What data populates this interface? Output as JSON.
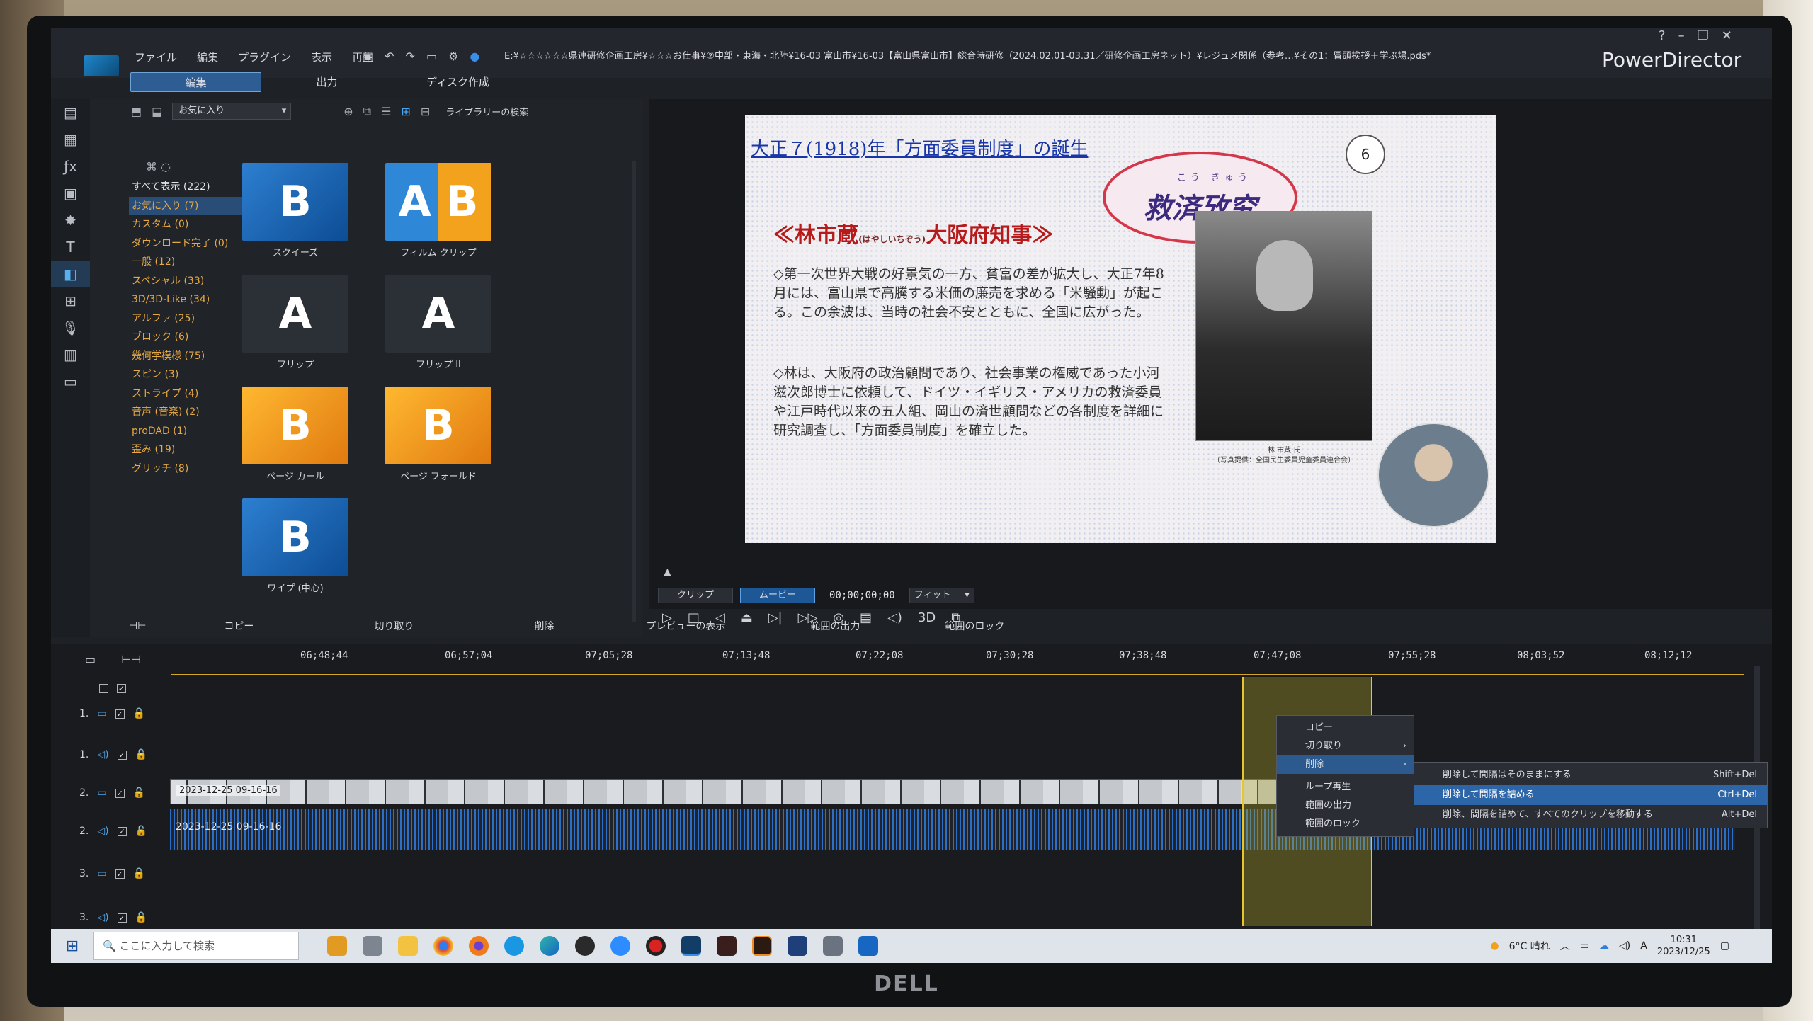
{
  "monitor_brand": "DELL",
  "menu": [
    "ファイル",
    "編集",
    "プラグイン",
    "表示",
    "再生"
  ],
  "project_path": "E:¥☆☆☆☆☆☆県連研修企画工房¥☆☆☆お仕事¥②中部・東海・北陸¥16-03 富山市¥16-03【富山県富山市】総合時研修（2024.02.01-03.31／研修企画工房ネット）¥レジュメ関係（参考…¥その1：冒頭挨拶＋学ぶ場.pds*",
  "app_name": "PowerDirector",
  "win_controls": [
    "?",
    "–",
    "❐",
    "✕"
  ],
  "modes": [
    "編集",
    "出力",
    "ディスク作成"
  ],
  "library": {
    "dropdown": "お気に入り",
    "link": "ライブラリーの検索",
    "categories": [
      "すべて表示 (222)",
      "お気に入り (7)",
      "カスタム (0)",
      "ダウンロード完了 (0)",
      "一般 (12)",
      "スペシャル (33)",
      "3D/3D-Like (34)",
      "アルファ (25)",
      "ブロック (6)",
      "幾何学模様 (75)",
      "スピン (3)",
      "ストライプ (4)",
      "音声 (音楽) (2)",
      "proDAD (1)",
      "歪み (19)",
      "グリッチ (8)"
    ],
    "thumbnails": [
      {
        "label": "スクイーズ",
        "glyph": "B"
      },
      {
        "label": "フィルム クリップ",
        "glyph": "A B"
      },
      {
        "label": "フリップ",
        "glyph": "A"
      },
      {
        "label": "フリップ II",
        "glyph": "A"
      },
      {
        "label": "ページ カール",
        "glyph": "B"
      },
      {
        "label": "ページ フォールド",
        "glyph": "B"
      },
      {
        "label": "ワイプ (中心)",
        "glyph": "B"
      }
    ]
  },
  "slide": {
    "title": "大正７(1918)年「方面委員制度」の誕生",
    "number": "6",
    "stamp_ruby": "こう きゅう",
    "stamp": "救済攷究",
    "heading_left": "≪林市蔵",
    "heading_ruby": "(はやしいちぞう)",
    "heading_right": "大阪府知事≫",
    "bullet1": "◇第一次世界大戦の好景気の一方、貧富の差が拡大し、大正7年8月には、富山県で高騰する米価の廉売を求める「米騒動」が起こる。この余波は、当時の社会不安とともに、全国に広がった。",
    "bullet2": "◇林は、大阪府の政治顧問であり、社会事業の権威であった小河滋次郎博士に依頼して、ドイツ・イギリス・アメリカの救済委員や江戸時代以来の五人組、岡山の済世顧問などの各制度を詳細に研究調査し、「方面委員制度」を確立した。",
    "photo_caption": "林 市蔵 氏\n（写真提供：全国民生委員児童委員連合会）"
  },
  "player": {
    "clip_tab": "クリップ",
    "movie_tab": "ムービー",
    "timecode": "00;00;00;00",
    "fit": "フィット",
    "mode_3d": "3D"
  },
  "edit_bar": [
    "コピー",
    "切り取り",
    "削除",
    "プレビューの表示",
    "範囲の出力",
    "範囲のロック"
  ],
  "ruler_ticks": [
    "06;48;44",
    "06;57;04",
    "07;05;28",
    "07;13;48",
    "07;22;08",
    "07;30;28",
    "07;38;48",
    "07;47;08",
    "07;55;28",
    "08;03;52",
    "08;12;12"
  ],
  "tracks": [
    {
      "label": "1.",
      "type": "video"
    },
    {
      "label": "1.",
      "type": "audio"
    },
    {
      "label": "2.",
      "type": "video"
    },
    {
      "label": "2.",
      "type": "audio"
    },
    {
      "label": "3.",
      "type": "video"
    },
    {
      "label": "3.",
      "type": "audio"
    }
  ],
  "clips": {
    "video_label": "2023-12-25 09-16-16",
    "audio_label": "2023-12-25 09-16-16"
  },
  "context_menu": {
    "items": [
      "コピー",
      "切り取り",
      "削除",
      "ループ再生",
      "範囲の出力",
      "範囲のロック"
    ],
    "active": "削除",
    "submenu": [
      {
        "label": "削除して間隔はそのままにする",
        "key": "Shift+Del"
      },
      {
        "label": "削除して間隔を詰める",
        "key": "Ctrl+Del"
      },
      {
        "label": "削除、間隔を詰めて、すべてのクリップを移動する",
        "key": "Alt+Del"
      }
    ]
  },
  "taskbar": {
    "search_placeholder": "ここに入力して検索",
    "weather": "6°C 晴れ",
    "ime": "A",
    "time": "10:31",
    "date": "2023/12/25"
  }
}
